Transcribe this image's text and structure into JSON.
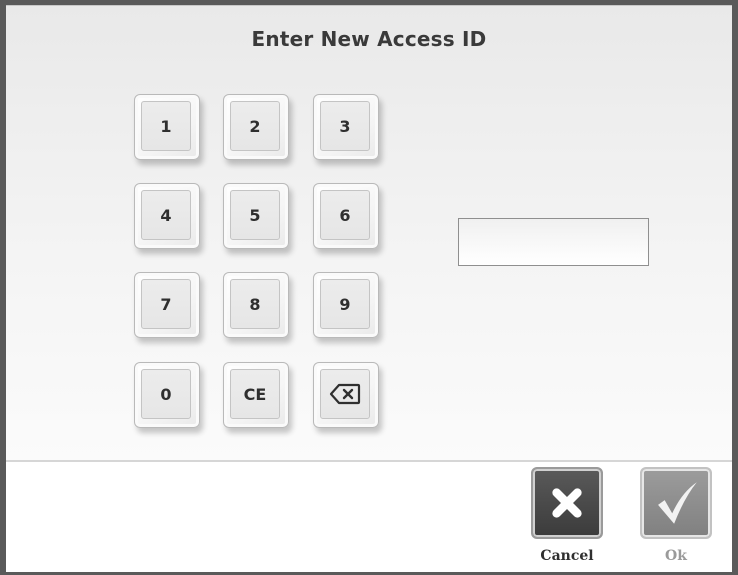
{
  "dialog": {
    "title": "Enter New Access ID",
    "access_id_value": ""
  },
  "keypad": {
    "keys": [
      "1",
      "2",
      "3",
      "4",
      "5",
      "6",
      "7",
      "8",
      "9",
      "0",
      "CE"
    ],
    "backspace_icon": "backspace-icon"
  },
  "actions": {
    "cancel_label": "Cancel",
    "ok_label": "Ok",
    "cancel_icon": "close-icon",
    "ok_icon": "checkmark-icon"
  }
}
